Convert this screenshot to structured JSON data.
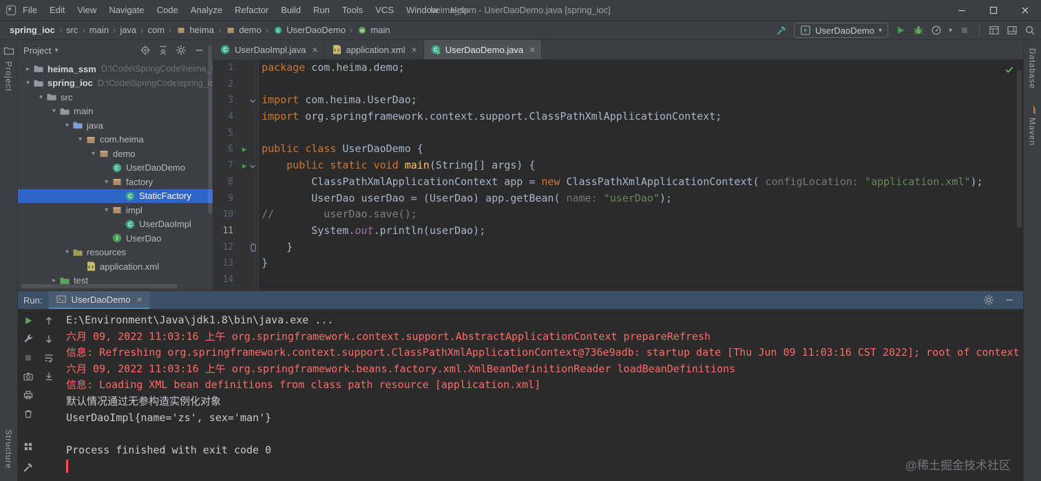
{
  "colors": {
    "panel_bg": "#3C3F41",
    "editor_bg": "#2B2B2B",
    "accent_blue": "#4A88C7",
    "selection_blue": "#2F65CA",
    "error_red": "#FF6B68",
    "run_green": "#499C54",
    "keyword_orange": "#CC7832",
    "string_green": "#6A8759"
  },
  "titlebar": {
    "menus": [
      "File",
      "Edit",
      "View",
      "Navigate",
      "Code",
      "Analyze",
      "Refactor",
      "Build",
      "Run",
      "Tools",
      "VCS",
      "Window",
      "Help"
    ],
    "title": "heima_ssm - UserDaoDemo.java [spring_ioc]",
    "window_controls": [
      "minimize",
      "maximize",
      "close"
    ]
  },
  "navbar": {
    "breadcrumbs": [
      {
        "label": "spring_ioc",
        "bold": true
      },
      {
        "label": "src"
      },
      {
        "label": "main"
      },
      {
        "label": "java"
      },
      {
        "label": "com"
      },
      {
        "label": "heima",
        "icon": "package"
      },
      {
        "label": "demo",
        "icon": "package"
      },
      {
        "label": "UserDaoDemo",
        "icon": "class"
      },
      {
        "label": "main",
        "icon": "method"
      }
    ],
    "run_config": "UserDaoDemo",
    "toolbar": [
      {
        "icon": "hammer",
        "name": "build-project-icon"
      },
      {
        "type": "combo"
      },
      {
        "icon": "run",
        "name": "run-button"
      },
      {
        "icon": "debug",
        "name": "debug-button"
      },
      {
        "icon": "profiler",
        "name": "profiler-button",
        "caret": true
      },
      {
        "icon": "stop",
        "name": "stop-button",
        "disabled": true
      },
      {
        "type": "sep"
      },
      {
        "icon": "restore-layout",
        "name": "restore-layout-icon"
      },
      {
        "icon": "tool-windows",
        "name": "tool-windows-icon"
      },
      {
        "icon": "search",
        "name": "search-everywhere-icon"
      }
    ]
  },
  "left_strip": {
    "top_label": "Project",
    "bottom_label": "Structure"
  },
  "right_strip": {
    "top_label": "Database",
    "bottom_label": "Maven"
  },
  "project_panel": {
    "title": "Project",
    "header_icons": [
      {
        "icon": "locate-file",
        "name": "locate-file-icon"
      },
      {
        "icon": "collapse-all",
        "name": "collapse-all-icon"
      },
      {
        "icon": "settings",
        "name": "settings-icon"
      },
      {
        "icon": "hide",
        "name": "hide-panel-icon"
      }
    ],
    "tree": [
      {
        "label": "heima_ssm",
        "suffix": "D:\\Code\\SpringCode\\heima_ssm",
        "level": 0,
        "arrow": "collapsed",
        "icon": "folder",
        "bold": true
      },
      {
        "label": "spring_ioc",
        "suffix": "D:\\Code\\SpringCode\\spring_ioc",
        "level": 0,
        "arrow": "expanded",
        "icon": "folder",
        "bold": true
      },
      {
        "label": "src",
        "level": 1,
        "arrow": "expanded",
        "icon": "folder"
      },
      {
        "label": "main",
        "level": 2,
        "arrow": "expanded",
        "icon": "folder"
      },
      {
        "label": "java",
        "level": 3,
        "arrow": "expanded",
        "icon": "folder-src"
      },
      {
        "label": "com.heima",
        "level": 4,
        "arrow": "expanded",
        "icon": "package"
      },
      {
        "label": "demo",
        "level": 5,
        "arrow": "expanded",
        "icon": "package"
      },
      {
        "label": "UserDaoDemo",
        "level": 6,
        "icon": "class"
      },
      {
        "label": "factory",
        "level": 6,
        "arrow": "expanded",
        "icon": "package"
      },
      {
        "label": "StaticFactory",
        "level": 7,
        "icon": "class",
        "selected": true
      },
      {
        "label": "impl",
        "level": 6,
        "arrow": "expanded",
        "icon": "package"
      },
      {
        "label": "UserDaoImpl",
        "level": 7,
        "icon": "class"
      },
      {
        "label": "UserDao",
        "level": 6,
        "icon": "interface"
      },
      {
        "label": "resources",
        "level": 3,
        "arrow": "expanded",
        "icon": "folder-res"
      },
      {
        "label": "application.xml",
        "level": 4,
        "icon": "xml"
      },
      {
        "label": "test",
        "level": 2,
        "arrow": "collapsed",
        "icon": "folder-test"
      }
    ]
  },
  "editor": {
    "tabs": [
      {
        "label": "UserDaoImpl.java",
        "icon": "class",
        "active": false
      },
      {
        "label": "application.xml",
        "icon": "xml",
        "active": false
      },
      {
        "label": "UserDaoDemo.java",
        "icon": "class-run",
        "active": true
      }
    ],
    "active_line": 11,
    "inspection_status": "ok",
    "lines": [
      {
        "num": 1,
        "segs": [
          [
            "kw",
            "package"
          ],
          [
            "pl",
            " com.heima.demo;"
          ]
        ]
      },
      {
        "num": 2,
        "segs": []
      },
      {
        "num": 3,
        "fold": true,
        "segs": [
          [
            "kw",
            "import"
          ],
          [
            "pl",
            " com.heima.UserDao;"
          ]
        ]
      },
      {
        "num": 4,
        "segs": [
          [
            "kw",
            "import"
          ],
          [
            "pl",
            " org.springframework.context.support.ClassPathXmlApplicationContext;"
          ]
        ]
      },
      {
        "num": 5,
        "segs": []
      },
      {
        "num": 6,
        "run": true,
        "segs": [
          [
            "kw",
            "public"
          ],
          [
            "pl",
            " "
          ],
          [
            "kw",
            "class"
          ],
          [
            "pl",
            " UserDaoDemo {"
          ]
        ]
      },
      {
        "num": 7,
        "run": true,
        "fold": true,
        "segs": [
          [
            "pl",
            "    "
          ],
          [
            "kw",
            "public"
          ],
          [
            "pl",
            " "
          ],
          [
            "kw",
            "static"
          ],
          [
            "pl",
            " "
          ],
          [
            "kw",
            "void"
          ],
          [
            "pl",
            " "
          ],
          [
            "fn",
            "main"
          ],
          [
            "pl",
            "(String[] args) {"
          ]
        ]
      },
      {
        "num": 8,
        "segs": [
          [
            "pl",
            "        ClassPathXmlApplicationContext app = "
          ],
          [
            "kw",
            "new"
          ],
          [
            "pl",
            " ClassPathXmlApplicationContext( "
          ],
          [
            "hint",
            "configLocation:"
          ],
          [
            "pl",
            " "
          ],
          [
            "str",
            "\"application.xml\""
          ],
          [
            "pl",
            ");"
          ]
        ]
      },
      {
        "num": 9,
        "segs": [
          [
            "pl",
            "        UserDao userDao = (UserDao) app.getBean( "
          ],
          [
            "hint",
            "name:"
          ],
          [
            "pl",
            " "
          ],
          [
            "str",
            "\"userDao\""
          ],
          [
            "pl",
            ");"
          ]
        ]
      },
      {
        "num": 10,
        "segs": [
          [
            "cmt",
            "//        userDao.save();"
          ]
        ]
      },
      {
        "num": 11,
        "segs": [
          [
            "pl",
            "        System."
          ],
          [
            "fld",
            "out"
          ],
          [
            "pl",
            ".println(userDao);"
          ]
        ]
      },
      {
        "num": 12,
        "marker": true,
        "segs": [
          [
            "pl",
            "    }"
          ]
        ]
      },
      {
        "num": 13,
        "segs": [
          [
            "pl",
            "}"
          ]
        ]
      },
      {
        "num": 14,
        "segs": []
      }
    ]
  },
  "run_panel": {
    "label": "Run:",
    "tab": {
      "label": "UserDaoDemo",
      "icon": "console"
    },
    "header_icons": [
      {
        "icon": "settings-gear",
        "name": "run-settings-icon"
      },
      {
        "icon": "hide",
        "name": "hide-run-panel-icon"
      }
    ],
    "outer_toolbar": [
      {
        "icon": "rerun",
        "name": "rerun-button"
      },
      {
        "icon": "wrench",
        "name": "edit-configuration-icon"
      },
      {
        "icon": "stop",
        "name": "stop-run-button",
        "disabled": true
      },
      {
        "icon": "camera",
        "name": "thread-dump-icon"
      },
      {
        "icon": "printer",
        "name": "print-console-icon"
      },
      {
        "icon": "trash",
        "name": "clear-console-icon"
      }
    ],
    "outer_toolbar_bottom": [
      {
        "icon": "favorites",
        "name": "favorites-toolwindow-icon"
      },
      {
        "icon": "build-hammer",
        "name": "build-toolwindow-icon"
      }
    ],
    "console_toolbar": [
      {
        "icon": "up-arrow",
        "name": "prev-occurrence-icon"
      },
      {
        "icon": "down-arrow",
        "name": "next-occurrence-icon"
      },
      {
        "icon": "soft-wrap",
        "name": "soft-wrap-icon"
      },
      {
        "icon": "scroll-end",
        "name": "scroll-to-end-icon"
      }
    ],
    "console_lines": [
      {
        "text": "E:\\Environment\\Java\\jdk1.8\\bin\\java.exe ...",
        "cls": "normal"
      },
      {
        "text": "六月 09, 2022 11:03:16 上午 org.springframework.context.support.AbstractApplicationContext prepareRefresh",
        "cls": "error"
      },
      {
        "text": "信息: Refreshing org.springframework.context.support.ClassPathXmlApplicationContext@736e9adb: startup date [Thu Jun 09 11:03:16 CST 2022]; root of context",
        "cls": "error"
      },
      {
        "text": "六月 09, 2022 11:03:16 上午 org.springframework.beans.factory.xml.XmlBeanDefinitionReader loadBeanDefinitions",
        "cls": "error"
      },
      {
        "text": "信息: Loading XML bean definitions from class path resource [application.xml]",
        "cls": "error"
      },
      {
        "text": "默认情况通过无参构造实例化对象",
        "cls": "normal"
      },
      {
        "text": "UserDaoImpl{name='zs', sex='man'}",
        "cls": "normal"
      },
      {
        "text": "",
        "cls": "normal"
      },
      {
        "text": "Process finished with exit code 0",
        "cls": "normal"
      }
    ],
    "caret": true
  },
  "watermark": "@稀土掘金技术社区"
}
